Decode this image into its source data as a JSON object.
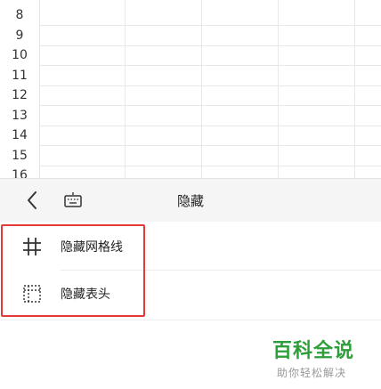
{
  "sheet": {
    "row_numbers": [
      "8",
      "9",
      "10",
      "11",
      "12",
      "13",
      "14",
      "15",
      "16"
    ]
  },
  "toolbar": {
    "back_icon": "chevron-left-icon",
    "keyboard_icon": "keyboard-icon",
    "title": "隐藏"
  },
  "menu": {
    "items": [
      {
        "label": "隐藏网格线",
        "icon": "grid-icon"
      },
      {
        "label": "隐藏表头",
        "icon": "table-header-icon"
      }
    ],
    "highlight_color": "#e53935"
  },
  "watermark": {
    "title": "百科全说",
    "subtitle": "助你轻松解决"
  }
}
